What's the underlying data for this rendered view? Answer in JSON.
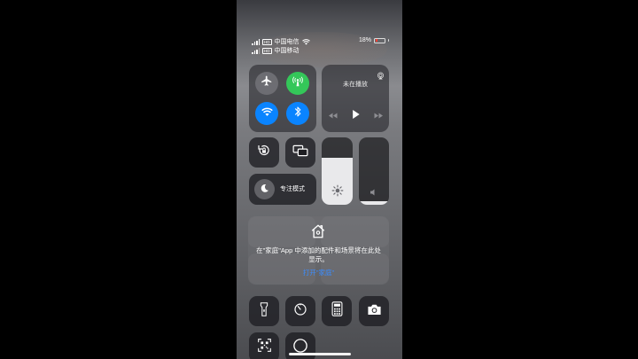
{
  "status_bar": {
    "line1": {
      "hd": "HD",
      "carrier": "中国电信"
    },
    "line2": {
      "hd": "HD",
      "carrier": "中国移动"
    },
    "battery_percent": "18%",
    "battery_level": 0.18
  },
  "connectivity": {
    "airplane": {
      "icon": "airplane-icon",
      "on": false
    },
    "cellular": {
      "icon": "antenna-icon",
      "on": true,
      "color": "#34c759"
    },
    "wifi": {
      "icon": "wifi-icon",
      "on": true,
      "color": "#0a84ff"
    },
    "bluetooth": {
      "icon": "bluetooth-icon",
      "on": true,
      "color": "#0a84ff"
    }
  },
  "media": {
    "title": "未在播放",
    "controls": [
      "rewind-icon",
      "play-icon",
      "fast-forward-icon"
    ]
  },
  "controls": {
    "rotation_lock": "rotation-lock-icon",
    "screen_mirroring": "screen-mirroring-icon",
    "focus_label": "专注模式",
    "brightness_level": 0.7,
    "volume_level": 0.05
  },
  "home": {
    "message": "在\"家庭\"App 中添加的配件和场景将在此处显示。",
    "link": "打开\"家庭\""
  },
  "bottom_buttons": [
    "flashlight-icon",
    "timer-icon",
    "calculator-icon",
    "camera-icon",
    "qr-scanner-icon",
    "screen-record-icon"
  ]
}
